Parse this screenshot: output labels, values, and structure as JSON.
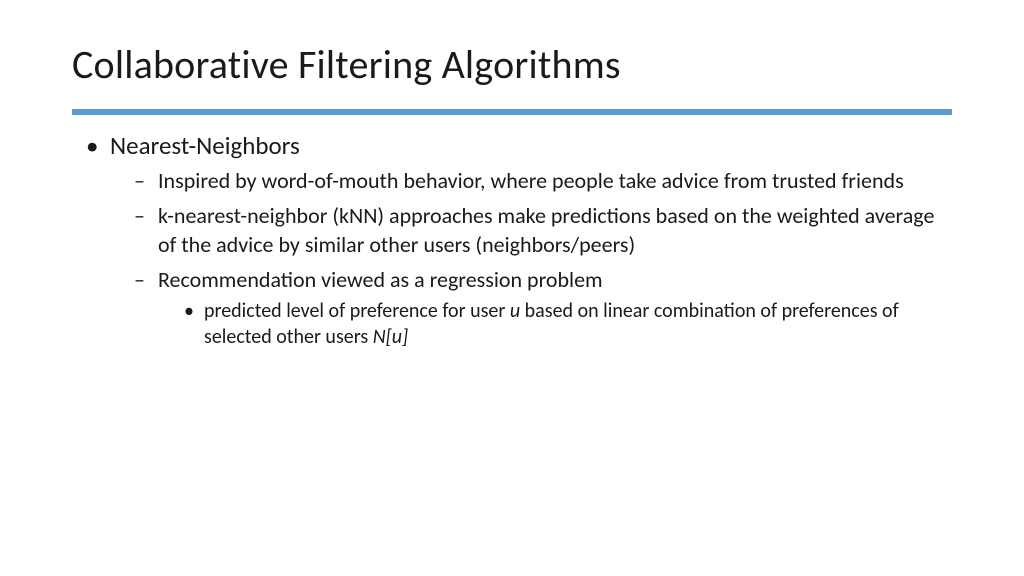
{
  "title": "Collaborative Filtering Algorithms",
  "l1_item": "Nearest-Neighbors",
  "l2_items": [
    "Inspired by word-of-mouth behavior, where people take advice from trusted friends",
    "k-nearest-neighbor (kNN) approaches make predictions based on the weighted average of the advice by similar other users (neighbors/peers)",
    "Recommendation viewed as a regression problem"
  ],
  "l3_parts": {
    "pre": "predicted level of preference for user ",
    "u": "u",
    "mid": " based on linear combination of preferences of selected other users ",
    "nu": "N[u]"
  }
}
